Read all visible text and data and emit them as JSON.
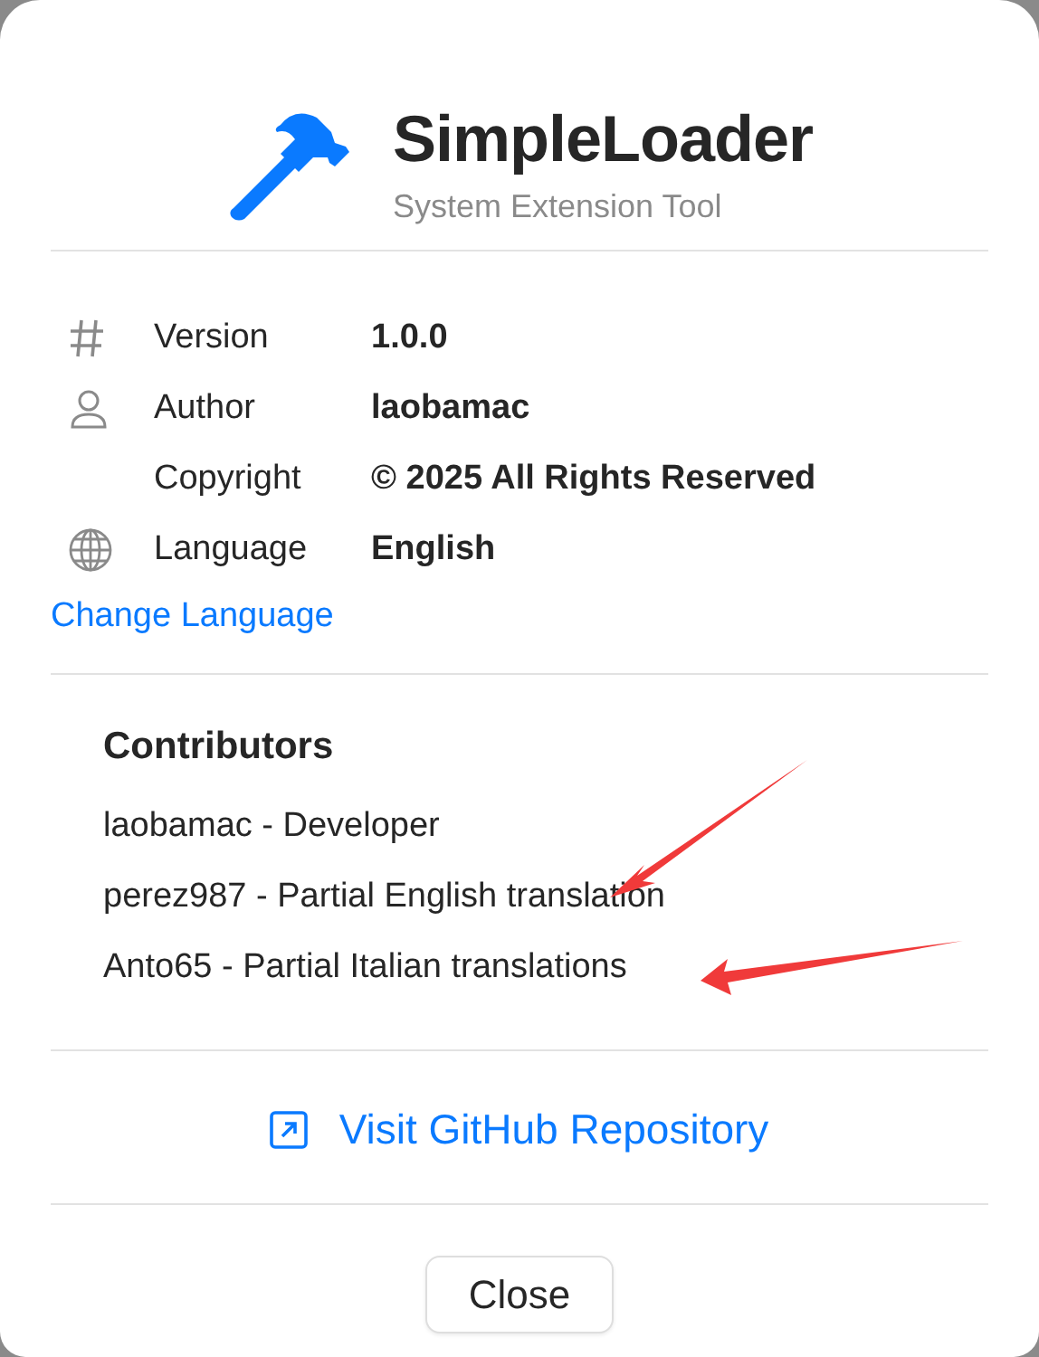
{
  "app": {
    "title": "SimpleLoader",
    "subtitle": "System Extension Tool"
  },
  "info_rows": [
    {
      "kind": "number",
      "label": "Version",
      "value": "1.0.0"
    },
    {
      "kind": "person",
      "label": "Author",
      "value": "laobamac"
    },
    {
      "kind": "plain",
      "label": "Copyright",
      "value": "© 2025 All Rights Reserved"
    },
    {
      "kind": "globe",
      "label": "Language",
      "value": "English"
    }
  ],
  "change_language_link": "Change Language",
  "contributors": {
    "heading": "Contributors",
    "items": [
      "laobamac - Developer",
      "perez987 - Partial English translation",
      "Anto65 - Partial Italian translations"
    ]
  },
  "github_link": "Visit GitHub Repository",
  "buttons": [
    "Close"
  ]
}
